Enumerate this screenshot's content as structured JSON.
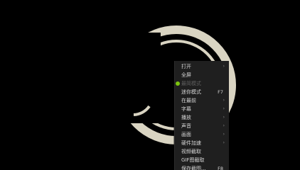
{
  "colors": {
    "background": "#000000",
    "ring": "#d9d4c2",
    "menu_bg": "#1f1f1f",
    "menu_text": "#d6d6d6",
    "menu_disabled": "#5f5f5f",
    "check_dot": "#7cc40f"
  },
  "menu": {
    "items": [
      {
        "label": "打开",
        "submenu": true
      },
      {
        "label": "全屏"
      },
      {
        "label": "最简模式",
        "disabled": true,
        "checked": true
      },
      {
        "label": "迷你模式",
        "shortcut": "F7"
      },
      {
        "label": "在最前",
        "submenu": true
      },
      {
        "label": "字幕",
        "submenu": true
      },
      {
        "label": "播放",
        "submenu": true
      },
      {
        "label": "声音",
        "submenu": true
      },
      {
        "label": "画面",
        "submenu": true
      },
      {
        "label": "硬件加速",
        "submenu": true
      },
      {
        "label": "视频截取"
      },
      {
        "label": "GIF图截取"
      },
      {
        "label": "保存截图...",
        "shortcut": "F8"
      }
    ],
    "arrow_glyph": "›"
  }
}
